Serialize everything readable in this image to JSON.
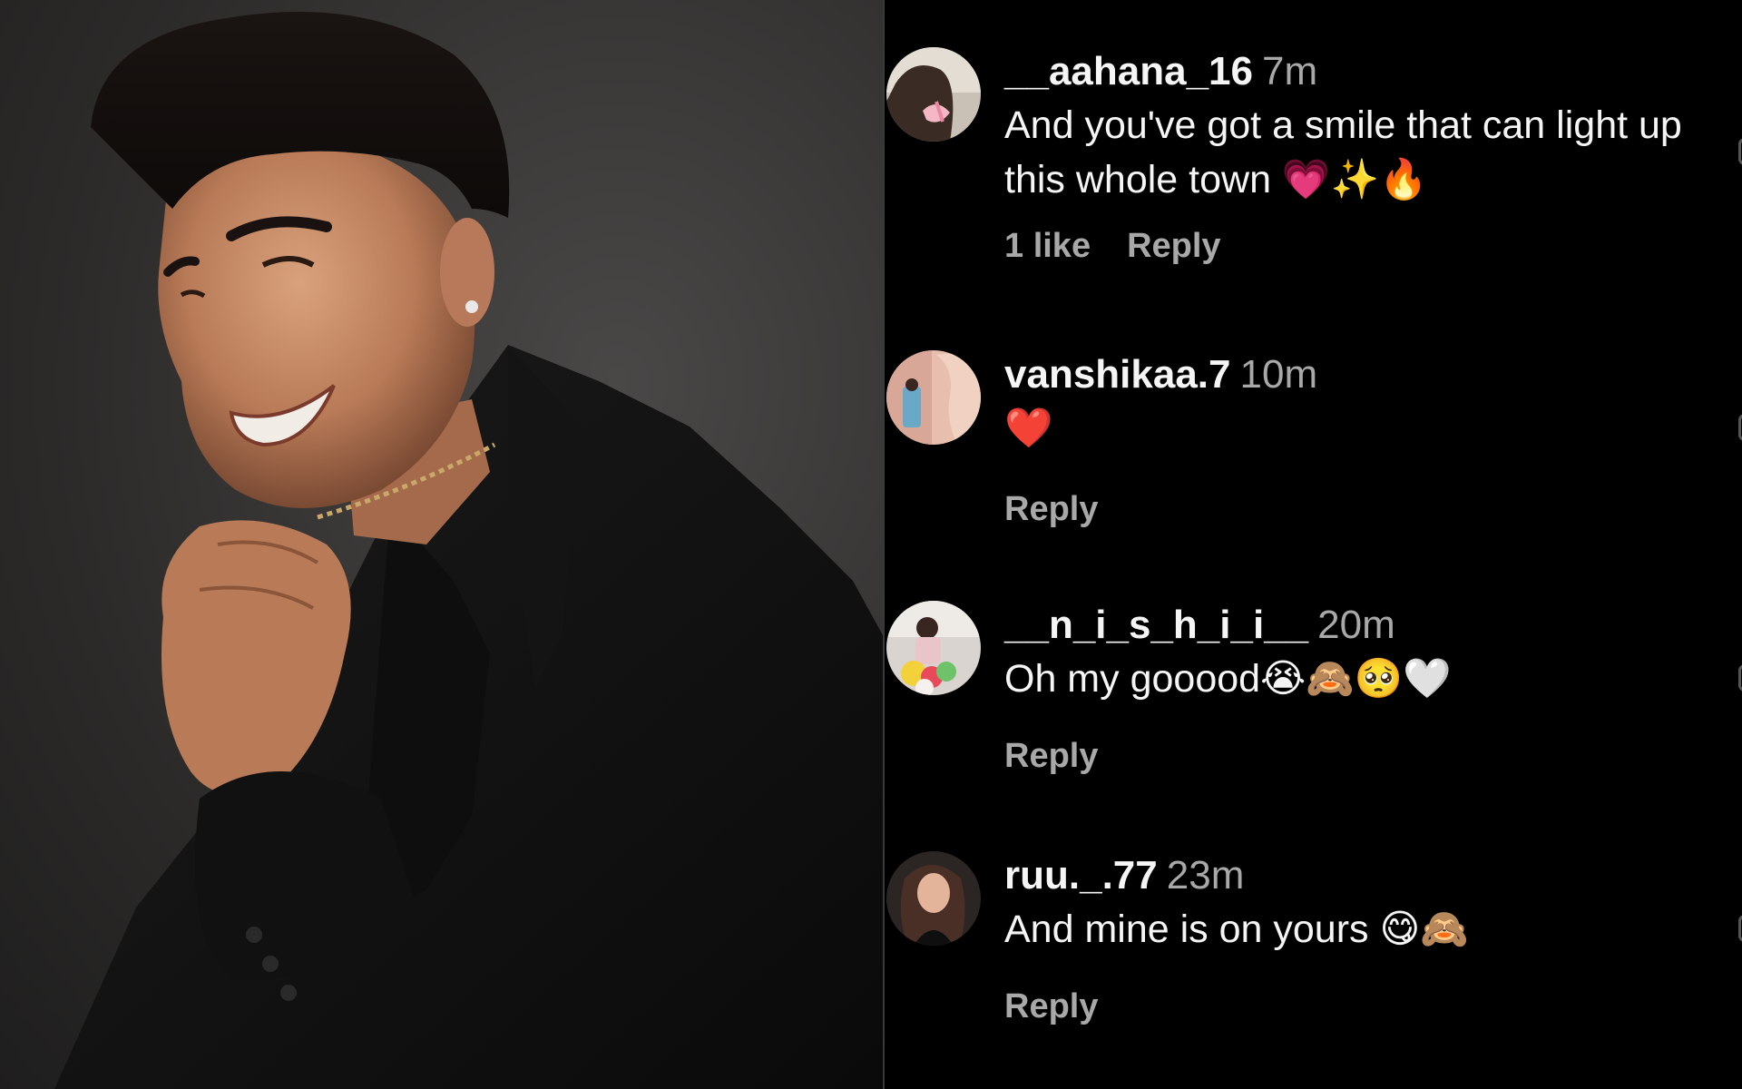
{
  "comments": [
    {
      "username": "__aahana_16",
      "time": "7m",
      "text": "And you've got a smile that can light up this whole town 💗✨🔥",
      "likes": "1 like",
      "reply": "Reply"
    },
    {
      "username": "vanshikaa.7",
      "time": "10m",
      "text": "❤️",
      "likes": "",
      "reply": "Reply"
    },
    {
      "username": "__n_i_s_h_i_i__",
      "time": "20m",
      "text": "Oh my gooood😭🙈🥺🤍",
      "likes": "",
      "reply": "Reply"
    },
    {
      "username": "ruu._.77",
      "time": "23m",
      "text": "And mine is on yours 😋🙈",
      "likes": "",
      "reply": "Reply"
    }
  ]
}
